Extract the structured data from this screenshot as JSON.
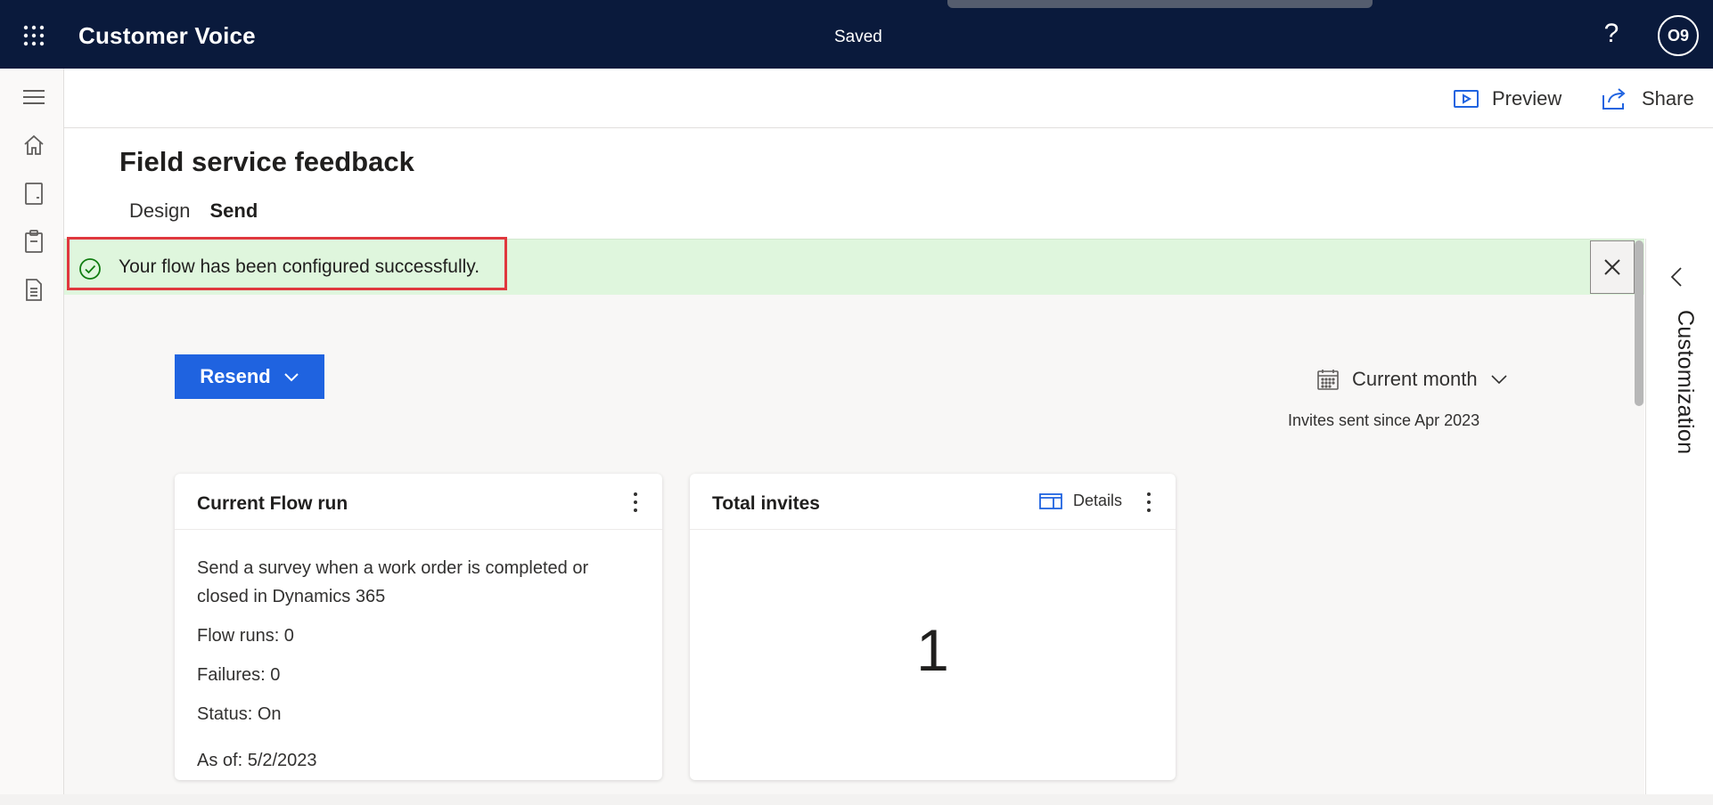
{
  "app": {
    "title": "Customer Voice",
    "save_status": "Saved",
    "help_label": "?",
    "user_initials": "O9"
  },
  "commandbar": {
    "preview_label": "Preview",
    "share_label": "Share"
  },
  "page": {
    "title": "Field service feedback"
  },
  "tabs": [
    {
      "label": "Design",
      "active": false
    },
    {
      "label": "Send",
      "active": true
    }
  ],
  "banner": {
    "message": "Your flow has been configured successfully.",
    "status_color": "#dff6dd",
    "icon": "check-circle-icon"
  },
  "actions": {
    "resend_label": "Resend"
  },
  "date_filter": {
    "label": "Current month",
    "caption": "Invites sent since Apr 2023"
  },
  "cards": {
    "flow": {
      "title": "Current Flow run",
      "description": "Send a survey when a work order is completed or closed in Dynamics 365",
      "flow_runs": "Flow runs: 0",
      "failures": "Failures: 0",
      "status": "Status: On",
      "as_of": "As of: 5/2/2023"
    },
    "invites": {
      "title": "Total invites",
      "details_label": "Details",
      "total": "1"
    }
  },
  "right_panel": {
    "label": "Customization"
  },
  "colors": {
    "header": "#0a1a3c",
    "primary": "#1f63e0",
    "highlight": "#e0383e"
  }
}
